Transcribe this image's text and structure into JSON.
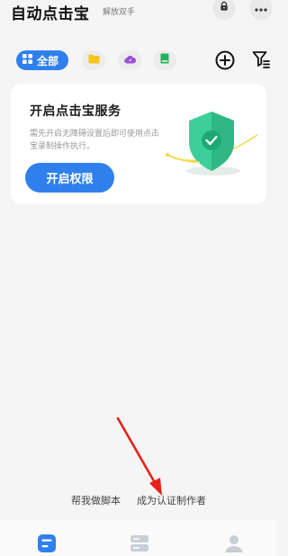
{
  "header": {
    "title": "自动点击宝",
    "subtitle": "解放双手",
    "icons": [
      "lock-icon",
      "more-icon"
    ]
  },
  "filters": {
    "all_label": "全部",
    "icons": [
      "grid-icon",
      "folder-icon",
      "cloud-icon",
      "book-icon",
      "add-icon",
      "sort-icon"
    ],
    "colors": {
      "active": "#2f80ed",
      "folder": "#f5c518",
      "cloud": "#9b4fd6",
      "book": "#22b35e"
    }
  },
  "card": {
    "title": "开启点击宝服务",
    "description": "需先开启无障碍设置后即可使用点击宝录制操作执行。",
    "button_label": "开启权限",
    "icon": "shield-check-icon",
    "colors": {
      "shield": "#3ccf9a",
      "ring": "#f0d94a"
    }
  },
  "footer": {
    "help_link": "帮我做脚本",
    "creator_link": "成为认证制作者",
    "annotation_arrow_color": "#e8201a"
  },
  "tabbar": {
    "icons": [
      "home-tab-icon",
      "scripts-tab-icon",
      "profile-tab-icon"
    ],
    "active_color": "#2f80ed"
  }
}
